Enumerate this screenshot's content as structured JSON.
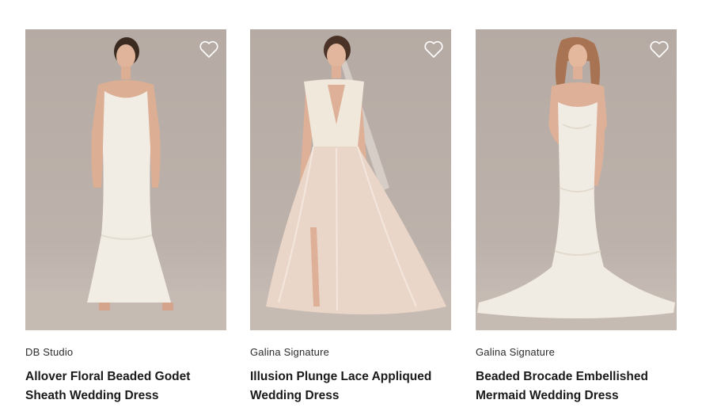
{
  "products": [
    {
      "brand": "DB Studio",
      "title": "Allover Floral Beaded Godet Sheath Wedding Dress",
      "icon": "heart-outline-icon"
    },
    {
      "brand": "Galina Signature",
      "title": "Illusion Plunge Lace Appliqued Wedding Dress",
      "icon": "heart-outline-icon"
    },
    {
      "brand": "Galina Signature",
      "title": "Beaded Brocade Embellished Mermaid Wedding Dress",
      "icon": "heart-outline-icon"
    }
  ],
  "colors": {
    "photo_background": "#b8ada6",
    "dress_ivory": "#f2ede4",
    "dress_blush": "#ead6c8",
    "heart_outline": "#ffffff"
  }
}
